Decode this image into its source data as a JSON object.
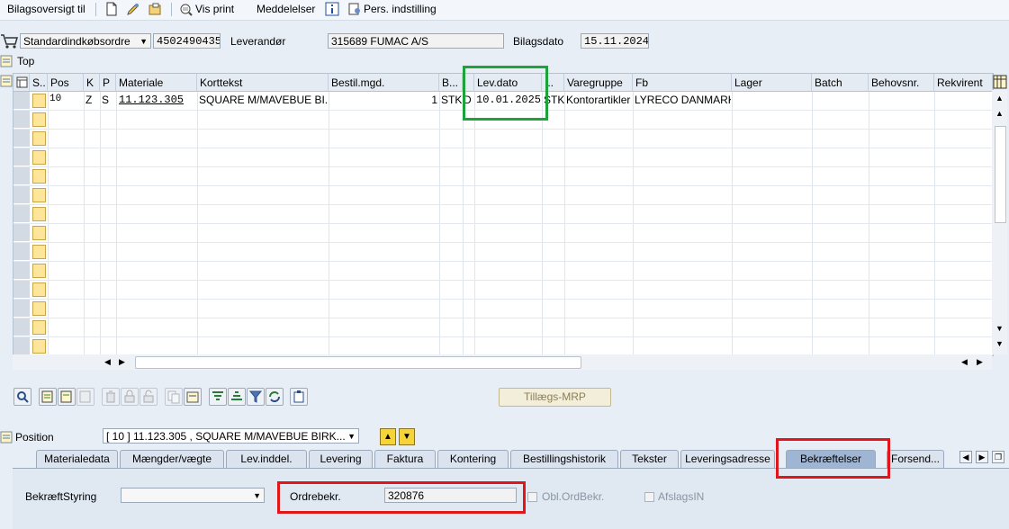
{
  "toolbar": {
    "bilagsoversigt": "Bilagsoversigt til",
    "vis_print": "Vis print",
    "meddelelser": "Meddelelser",
    "pers_indstilling": "Pers. indstilling"
  },
  "header": {
    "order_type": "Standardindkøbsordre",
    "order_number": "4502490435",
    "vendor_label": "Leverandør",
    "vendor_value": "315689 FUMAC A/S",
    "doc_date_label": "Bilagsdato",
    "doc_date_value": "15.11.2024"
  },
  "top_label": "Top",
  "grid": {
    "columns": [
      "S..",
      "Pos",
      "K",
      "P",
      "Materiale",
      "Korttekst",
      "Bestil.mgd.",
      "B...",
      "",
      "Lev.dato",
      "...",
      "Varegruppe",
      "Fb",
      "Lager",
      "Batch",
      "Behovsnr.",
      "Rekvirent"
    ],
    "row1": {
      "pos": "10",
      "k": "Z",
      "p": "S",
      "materiale": "11.123.305",
      "korttekst": "SQUARE M/MAVEBUE BI...",
      "bestil_mgd": "1",
      "b": "STK",
      "d": "D",
      "lev_dato": "10.01.2025",
      "stk": "STK",
      "varegruppe": "Kontorartikler",
      "fb": "LYRECO DANMARK..."
    }
  },
  "mrp_button": "Tillægs-MRP",
  "position": {
    "label": "Position",
    "value": "[ 10 ] 11.123.305 , SQUARE M/MAVEBUE BIRK..."
  },
  "tabs": [
    "Materialedata",
    "Mængder/vægte",
    "Lev.inddel.",
    "Levering",
    "Faktura",
    "Kontering",
    "Bestillingshistorik",
    "Tekster",
    "Leveringsadresse",
    "Bekræftelser",
    "Forsend..."
  ],
  "panel": {
    "bekraeft_label": "BekræftStyring",
    "bekraeft_value": "",
    "ordrebekr_label": "Ordrebekr.",
    "ordrebekr_value": "320876",
    "obl_label": "Obl.OrdBekr.",
    "afslags_label": "AfslagsIN"
  },
  "colors": {
    "highlight_red": "#e0161a",
    "highlight_green": "#1ea33a",
    "active_tab": "#9fb5d4"
  }
}
